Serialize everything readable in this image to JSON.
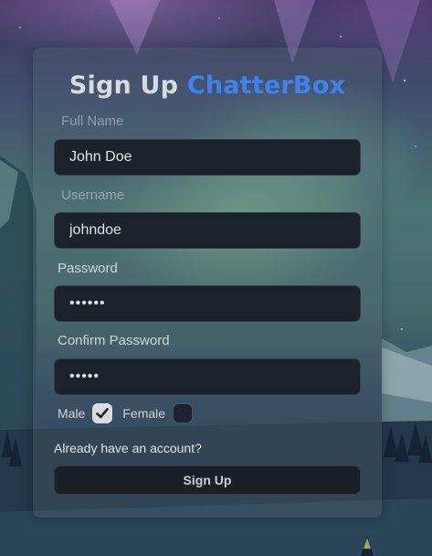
{
  "header": {
    "title_prefix": "Sign Up",
    "brand": "ChatterBox"
  },
  "form": {
    "full_name": {
      "label": "Full Name",
      "value": "John Doe"
    },
    "username": {
      "label": "Username",
      "value": "johndoe"
    },
    "password": {
      "label": "Password",
      "value": "••••••"
    },
    "confirm_password": {
      "label": "Confirm Password",
      "value": "•••••"
    },
    "gender": {
      "male_label": "Male",
      "male_checked": true,
      "female_label": "Female",
      "female_checked": false
    },
    "account_link": "Already have an account?",
    "submit_label": "Sign Up"
  },
  "colors": {
    "brand": "#3c83f0",
    "input_bg": "#1c222b",
    "button_bg": "#1b2027"
  },
  "icons": {
    "check": "checkmark-icon"
  }
}
